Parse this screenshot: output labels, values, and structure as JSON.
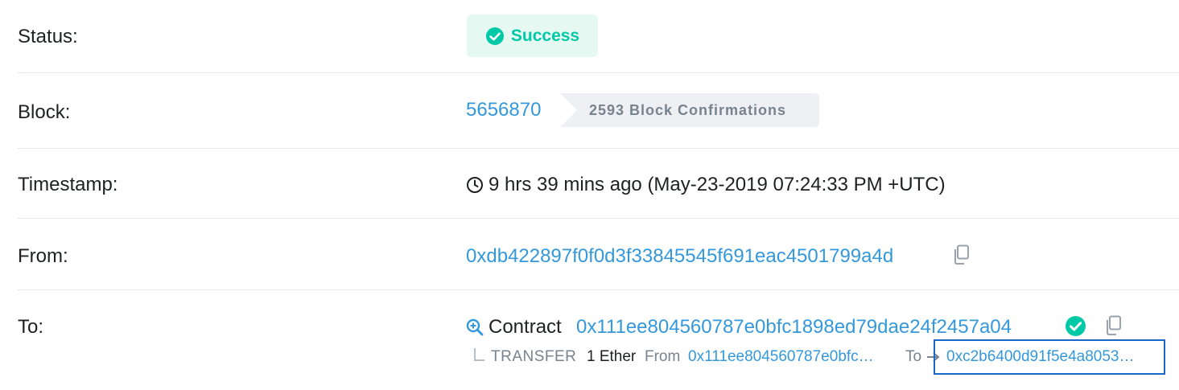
{
  "status": {
    "label": "Status:",
    "value": "Success"
  },
  "block": {
    "label": "Block:",
    "number": "5656870",
    "confirmations": "2593 Block Confirmations"
  },
  "timestamp": {
    "label": "Timestamp:",
    "value": "9 hrs 39 mins ago (May-23-2019 07:24:33 PM +UTC)"
  },
  "from": {
    "label": "From:",
    "address": "0xdb422897f0f0d3f33845545f691eac4501799a4d"
  },
  "to": {
    "label": "To:",
    "prefix": "Contract",
    "address": "0x111ee804560787e0bfc1898ed79dae24f2457a04",
    "transfer": {
      "type": "TRANSFER",
      "amount": "1 Ether",
      "from_label": "From",
      "from_address": "0x111ee804560787e0bfc…",
      "to_label": "To",
      "to_address": "0xc2b6400d91f5e4a8053…"
    }
  },
  "colors": {
    "link": "#3498db",
    "success": "#00c9a7",
    "muted": "#77838f",
    "divider": "#e7eaf3"
  }
}
